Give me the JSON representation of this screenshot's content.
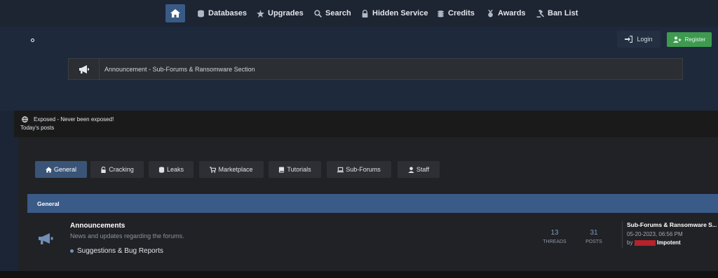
{
  "nav": {
    "items": [
      {
        "label": "Databases",
        "icon": "database-icon"
      },
      {
        "label": "Upgrades",
        "icon": "star-icon"
      },
      {
        "label": "Search",
        "icon": "search-icon"
      },
      {
        "label": "Hidden Service",
        "icon": "lock-icon"
      },
      {
        "label": "Credits",
        "icon": "coins-icon"
      },
      {
        "label": "Awards",
        "icon": "medal-icon"
      },
      {
        "label": "Ban List",
        "icon": "gavel-icon"
      }
    ]
  },
  "auth": {
    "login_label": "Login",
    "register_label": "Register"
  },
  "announcement": {
    "text": "Announcement - Sub-Forums & Ransomware Section"
  },
  "status": {
    "exposed_text": "Exposed - Never been exposed!",
    "todays_posts": "Today's posts"
  },
  "tabs": [
    {
      "label": "General",
      "icon": "home-icon",
      "active": true
    },
    {
      "label": "Cracking",
      "icon": "unlock-icon",
      "active": false
    },
    {
      "label": "Leaks",
      "icon": "database-icon",
      "active": false
    },
    {
      "label": "Marketplace",
      "icon": "cart-icon",
      "active": false
    },
    {
      "label": "Tutorials",
      "icon": "book-icon",
      "active": false
    },
    {
      "label": "Sub-Forums",
      "icon": "laptop-icon",
      "active": false
    },
    {
      "label": "Staff",
      "icon": "user-icon",
      "active": false
    }
  ],
  "section": {
    "title": "General"
  },
  "forum": {
    "title": "Announcements",
    "description": "News and updates regarding the forums.",
    "subforum": "Suggestions & Bug Reports",
    "threads_count": "13",
    "threads_label": "THREADS",
    "posts_count": "31",
    "posts_label": "POSTS",
    "last_post": {
      "title": "Sub-Forums & Ransomware S...",
      "date": "05-20-2023, 06:56 PM",
      "by": "by",
      "author": "Impotent"
    }
  },
  "colors": {
    "accent": "#3a5a88",
    "register": "#3d9a4f",
    "redacted": "#b8222b"
  }
}
